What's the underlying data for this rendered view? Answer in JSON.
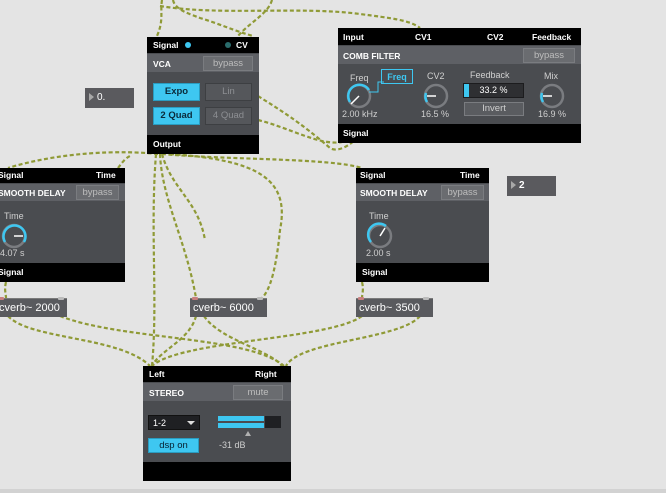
{
  "vca": {
    "signal_label": "Signal",
    "cv_label": "CV",
    "title": "VCA",
    "bypass_label": "bypass",
    "expo_label": "Expo",
    "lin_label": "Lin",
    "quad2_label": "2 Quad",
    "quad4_label": "4 Quad",
    "output_label": "Output"
  },
  "comb_filter": {
    "input_label": "Input",
    "cv1_label": "CV1",
    "cv2_label": "CV2",
    "feedback_label_top": "Feedback",
    "title": "COMB FILTER",
    "bypass_label": "bypass",
    "freq_label": "Freq",
    "freq_toggle_label": "Freq",
    "freq_value": "2.00 kHz",
    "cv2_knob_label": "CV2",
    "cv2_value": "16.5 %",
    "feedback_label": "Feedback",
    "feedback_value": "33.2 %",
    "feedback_level": 0.332,
    "invert_label": "Invert",
    "mix_label": "Mix",
    "mix_value": "16.9 %",
    "signal_label": "Signal"
  },
  "number_box_left": {
    "value": "0."
  },
  "number_box_right": {
    "value": "2"
  },
  "smooth_delay_left": {
    "signal_label": "Signal",
    "time_label_top": "Time",
    "title": "SMOOTH DELAY",
    "bypass_label": "bypass",
    "time_label": "Time",
    "time_value": "4.07 s",
    "output_label": "Signal"
  },
  "smooth_delay_right": {
    "signal_label": "Signal",
    "time_label_top": "Time",
    "title": "SMOOTH DELAY",
    "bypass_label": "bypass",
    "time_label": "Time",
    "time_value": "2.00 s",
    "output_label": "Signal"
  },
  "cverb_objects": [
    {
      "text": "cverb~ 2000"
    },
    {
      "text": "cverb~ 6000"
    },
    {
      "text": "cverb~ 3500"
    }
  ],
  "stereo": {
    "left_label": "Left",
    "right_label": "Right",
    "title": "STEREO",
    "mute_label": "mute",
    "channel_select": "1-2",
    "dsp_label": "dsp on",
    "level_value": "-31 dB"
  },
  "colors": {
    "accent": "#3ec7f1",
    "device_bg": "#4a4c50",
    "header_bg": "#5e6065",
    "patch_cord": "#8f9a36"
  }
}
